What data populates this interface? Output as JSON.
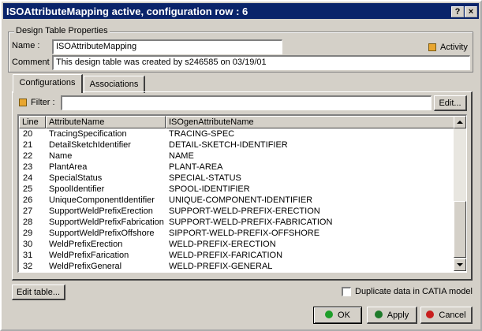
{
  "window": {
    "title": "ISOAttributeMapping active, configuration row : 6",
    "help_label": "?",
    "close_label": "×"
  },
  "properties": {
    "group_label": "Design Table Properties",
    "name_label": "Name :",
    "name_value": "ISOAttributeMapping",
    "activity_label": "Activity",
    "comment_label": "Comment :",
    "comment_value": "This design table was created by s246585 on 03/19/01"
  },
  "tabs": [
    {
      "label": "Configurations"
    },
    {
      "label": "Associations"
    }
  ],
  "filter": {
    "label": "Filter :",
    "value": "",
    "edit_label": "Edit..."
  },
  "table": {
    "columns": [
      "Line",
      "AttributeName",
      "ISOgenAttributeName"
    ],
    "rows": [
      [
        "20",
        "TracingSpecification",
        "TRACING-SPEC"
      ],
      [
        "21",
        "DetailSketchIdentifier",
        "DETAIL-SKETCH-IDENTIFIER"
      ],
      [
        "22",
        "Name",
        "NAME"
      ],
      [
        "23",
        "PlantArea",
        "PLANT-AREA"
      ],
      [
        "24",
        "SpecialStatus",
        "SPECIAL-STATUS"
      ],
      [
        "25",
        "SpoolIdentifier",
        "SPOOL-IDENTIFIER"
      ],
      [
        "26",
        "UniqueComponentIdentifier",
        "UNIQUE-COMPONENT-IDENTIFIER"
      ],
      [
        "27",
        "SupportWeldPrefixErection",
        "SUPPORT-WELD-PREFIX-ERECTION"
      ],
      [
        "28",
        "SupportWeldPrefixFabrication",
        "SUPPORT-WELD-PREFIX-FABRICATION"
      ],
      [
        "29",
        "SupportWeldPrefixOffshore",
        "SIPPORT-WELD-PREFIX-OFFSHORE"
      ],
      [
        "30",
        "WeldPrefixErection",
        "WELD-PREFIX-ERECTION"
      ],
      [
        "31",
        "WeldPrefixFarication",
        "WELD-PREFIX-FARICATION"
      ],
      [
        "32",
        "WeldPrefixGeneral",
        "WELD-PREFIX-GENERAL"
      ]
    ]
  },
  "footer": {
    "edit_table_label": "Edit table...",
    "duplicate_label": "Duplicate data in CATIA model",
    "ok_label": "OK",
    "apply_label": "Apply",
    "cancel_label": "Cancel"
  },
  "colors": {
    "title_bar": "#0a246a",
    "ok_dot": "#1e9e2a",
    "apply_dot": "#1e7a2a",
    "cancel_dot": "#c81e1e"
  }
}
